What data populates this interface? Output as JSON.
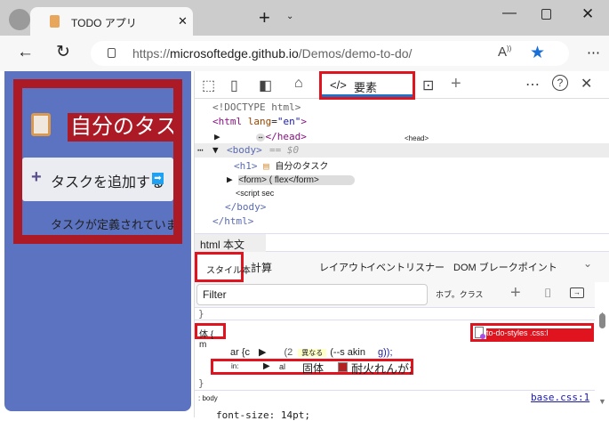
{
  "browser": {
    "tab_title": "TODO アプリ",
    "url_host": "microsoftedge.github.io",
    "url_prefix": "https://",
    "url_path": "/Demos/demo-to-do/",
    "new_tab": "+",
    "tab_close": "✕"
  },
  "page": {
    "heading": "自分のタスク",
    "add_button": "タスクを追加する",
    "empty_message": "タスクが定義されていません",
    "colors": {
      "panel": "#5b73c0",
      "border": "#ac1a25"
    }
  },
  "devtools": {
    "elements_tab": "要素",
    "dom": {
      "doctype": "<!DOCTYPE html>",
      "html_open": "<html",
      "lang_attr": "lang",
      "lang_val": "\"en\"",
      "head_close": "</head>",
      "head_label": "<head>",
      "body_tag": "<body>",
      "body_eq": "== $0",
      "h1_tag": "<h1>",
      "h1_text": "自分のタスク",
      "form": "<form> ( flex</form>",
      "script": "<script sec",
      "body_close": "</body>",
      "html_close": "</html>"
    },
    "breadcrumb": "html 本文",
    "panel_tabs": [
      "スタイル本",
      "計算",
      "レイアウト",
      "イベントリスナー",
      "DOM ブレークポイント"
    ],
    "filter_placeholder": "Filter",
    "hov_cls": "ホブ。クラス",
    "styles": {
      "brace": "}",
      "selector": "体 { m",
      "source": "to-do-styles .css:l",
      "line1_prop": "ar {c",
      "line1_num": "(2",
      "line1_hint": "異なる",
      "line1_var": "(--s akin",
      "line1_end": "g));",
      "line2_prop": "in:",
      "line2_al": "al",
      "line2_solid": "固体",
      "line2_color": "耐火れんが;",
      "close": "}",
      "rule2_selector": ": body",
      "rule2_source": "base.css:1",
      "rule2_prop": "font-size: 14pt;"
    }
  }
}
